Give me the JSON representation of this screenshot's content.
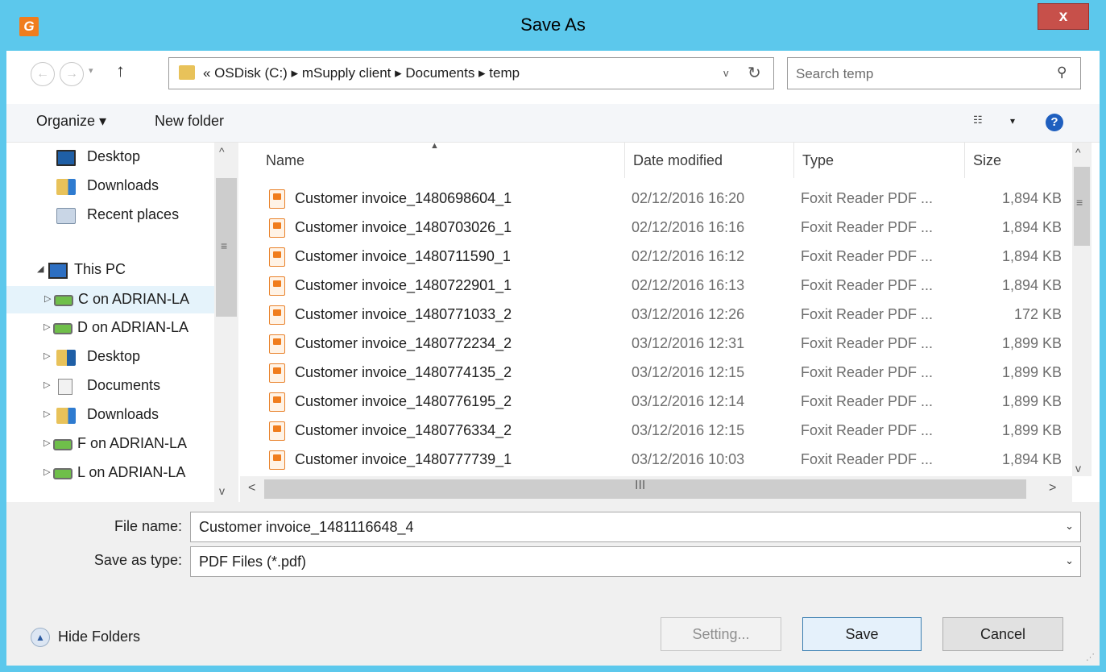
{
  "window": {
    "title": "Save As",
    "app_icon_glyph": "G",
    "close_glyph": "x"
  },
  "navigation": {
    "back_glyph": "←",
    "forward_glyph": "→",
    "recent_glyph": "▾",
    "up_glyph": "↑"
  },
  "address": {
    "path": "«  OSDisk (C:)  ▸  mSupply client  ▸  Documents  ▸  temp",
    "dropdown_glyph": "v",
    "refresh_glyph": "↻"
  },
  "search": {
    "placeholder": "Search temp",
    "icon_glyph": "⚲"
  },
  "toolbar": {
    "organize_label": "Organize ▾",
    "new_folder_label": "New folder",
    "view_glyph": "☷",
    "view_dd_glyph": "▾",
    "help_glyph": "?"
  },
  "nav_pane": {
    "items": [
      {
        "label": "Desktop",
        "arrow": ""
      },
      {
        "label": "Downloads",
        "arrow": ""
      },
      {
        "label": "Recent places",
        "arrow": ""
      },
      {
        "label": "This PC",
        "arrow": "◢"
      },
      {
        "label": "C on ADRIAN-LA",
        "arrow": "▷"
      },
      {
        "label": "D on ADRIAN-LA",
        "arrow": "▷"
      },
      {
        "label": "Desktop",
        "arrow": "▷"
      },
      {
        "label": "Documents",
        "arrow": "▷"
      },
      {
        "label": "Downloads",
        "arrow": "▷"
      },
      {
        "label": "F on ADRIAN-LA",
        "arrow": "▷"
      },
      {
        "label": "L on ADRIAN-LA",
        "arrow": "▷"
      }
    ],
    "selected_index": 4
  },
  "file_list": {
    "columns": {
      "name": "Name",
      "date_modified": "Date modified",
      "type": "Type",
      "size": "Size"
    },
    "rows": [
      {
        "name": "Customer invoice_1480698604_1",
        "date": "02/12/2016 16:20",
        "type": "Foxit Reader PDF ...",
        "size": "1,894 KB"
      },
      {
        "name": "Customer invoice_1480703026_1",
        "date": "02/12/2016 16:16",
        "type": "Foxit Reader PDF ...",
        "size": "1,894 KB"
      },
      {
        "name": "Customer invoice_1480711590_1",
        "date": "02/12/2016 16:12",
        "type": "Foxit Reader PDF ...",
        "size": "1,894 KB"
      },
      {
        "name": "Customer invoice_1480722901_1",
        "date": "02/12/2016 16:13",
        "type": "Foxit Reader PDF ...",
        "size": "1,894 KB"
      },
      {
        "name": "Customer invoice_1480771033_2",
        "date": "03/12/2016 12:26",
        "type": "Foxit Reader PDF ...",
        "size": "172 KB"
      },
      {
        "name": "Customer invoice_1480772234_2",
        "date": "03/12/2016 12:31",
        "type": "Foxit Reader PDF ...",
        "size": "1,899 KB"
      },
      {
        "name": "Customer invoice_1480774135_2",
        "date": "03/12/2016 12:15",
        "type": "Foxit Reader PDF ...",
        "size": "1,899 KB"
      },
      {
        "name": "Customer invoice_1480776195_2",
        "date": "03/12/2016 12:14",
        "type": "Foxit Reader PDF ...",
        "size": "1,899 KB"
      },
      {
        "name": "Customer invoice_1480776334_2",
        "date": "03/12/2016 12:15",
        "type": "Foxit Reader PDF ...",
        "size": "1,899 KB"
      },
      {
        "name": "Customer invoice_1480777739_1",
        "date": "03/12/2016 10:03",
        "type": "Foxit Reader PDF ...",
        "size": "1,894 KB"
      }
    ]
  },
  "scrollbars": {
    "up_glyph": "^",
    "down_glyph": "v",
    "left_glyph": "<",
    "right_glyph": ">",
    "grip_v": "≡",
    "grip_h": "III"
  },
  "form": {
    "file_name_label": "File name:",
    "file_name_value": "Customer invoice_1481116648_4",
    "save_type_label": "Save as type:",
    "save_type_value": "PDF Files (*.pdf)",
    "dropdown_glyph": "⌄"
  },
  "footer": {
    "hide_folders_label": "Hide Folders",
    "hide_folders_glyph": "▲",
    "setting_label": "Setting...",
    "save_label": "Save",
    "cancel_label": "Cancel",
    "resize_glyph": "⋰"
  },
  "colors": {
    "title_bar": "#5cc8ec",
    "close_button": "#c7504a",
    "selection": "#e5f3fb",
    "pdf_icon": "#f07d1d"
  }
}
